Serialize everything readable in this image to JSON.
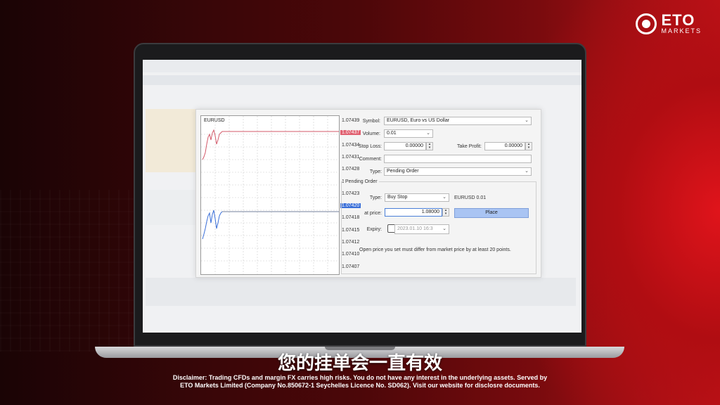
{
  "brand": {
    "name": "ETO",
    "sub": "MARKETS"
  },
  "subtitle": "您的挂单会一直有效",
  "disclaimer": {
    "line1": "Disclaimer: Trading CFDs and margin FX carries high risks. You do not have any interest in the underlying assets. Served by",
    "line2": "ETO Markets Limited  (Company No.850672-1 Seychelles Licence No. SD062). Visit our website for disclosre documents."
  },
  "order_dialog": {
    "chart": {
      "symbol": "EURUSD",
      "y_ticks": [
        "1.07439",
        "1.07437",
        "1.07434",
        "1.07431",
        "1.07428",
        "1.07426",
        "1.07423",
        "1.07420",
        "1.07418",
        "1.07415",
        "1.07412",
        "1.07410",
        "1.07407"
      ],
      "ask_level": "1.07437",
      "bid_level": "1.07420"
    },
    "symbol_label": "Symbol:",
    "symbol_value": "EURUSD, Euro vs US Dollar",
    "volume_label": "Volume:",
    "volume_value": "0.01",
    "stop_loss_label": "Stop Loss:",
    "stop_loss_value": "0.00000",
    "take_profit_label": "Take Profit:",
    "take_profit_value": "0.00000",
    "comment_label": "Comment:",
    "comment_value": "",
    "type_label": "Type:",
    "type_value": "Pending Order",
    "pending": {
      "group_title": "Pending Order",
      "type_label": "Type:",
      "type_value": "Buy Stop",
      "summary": "EURUSD 0.01",
      "price_label": "at price:",
      "price_value": "1.08000",
      "place_label": "Place",
      "expiry_label": "Expiry:",
      "expiry_value": "2023.01.10 16:3",
      "expiry_checked": false,
      "note": "Open price you set must differ from market price by at least 20 points."
    }
  }
}
